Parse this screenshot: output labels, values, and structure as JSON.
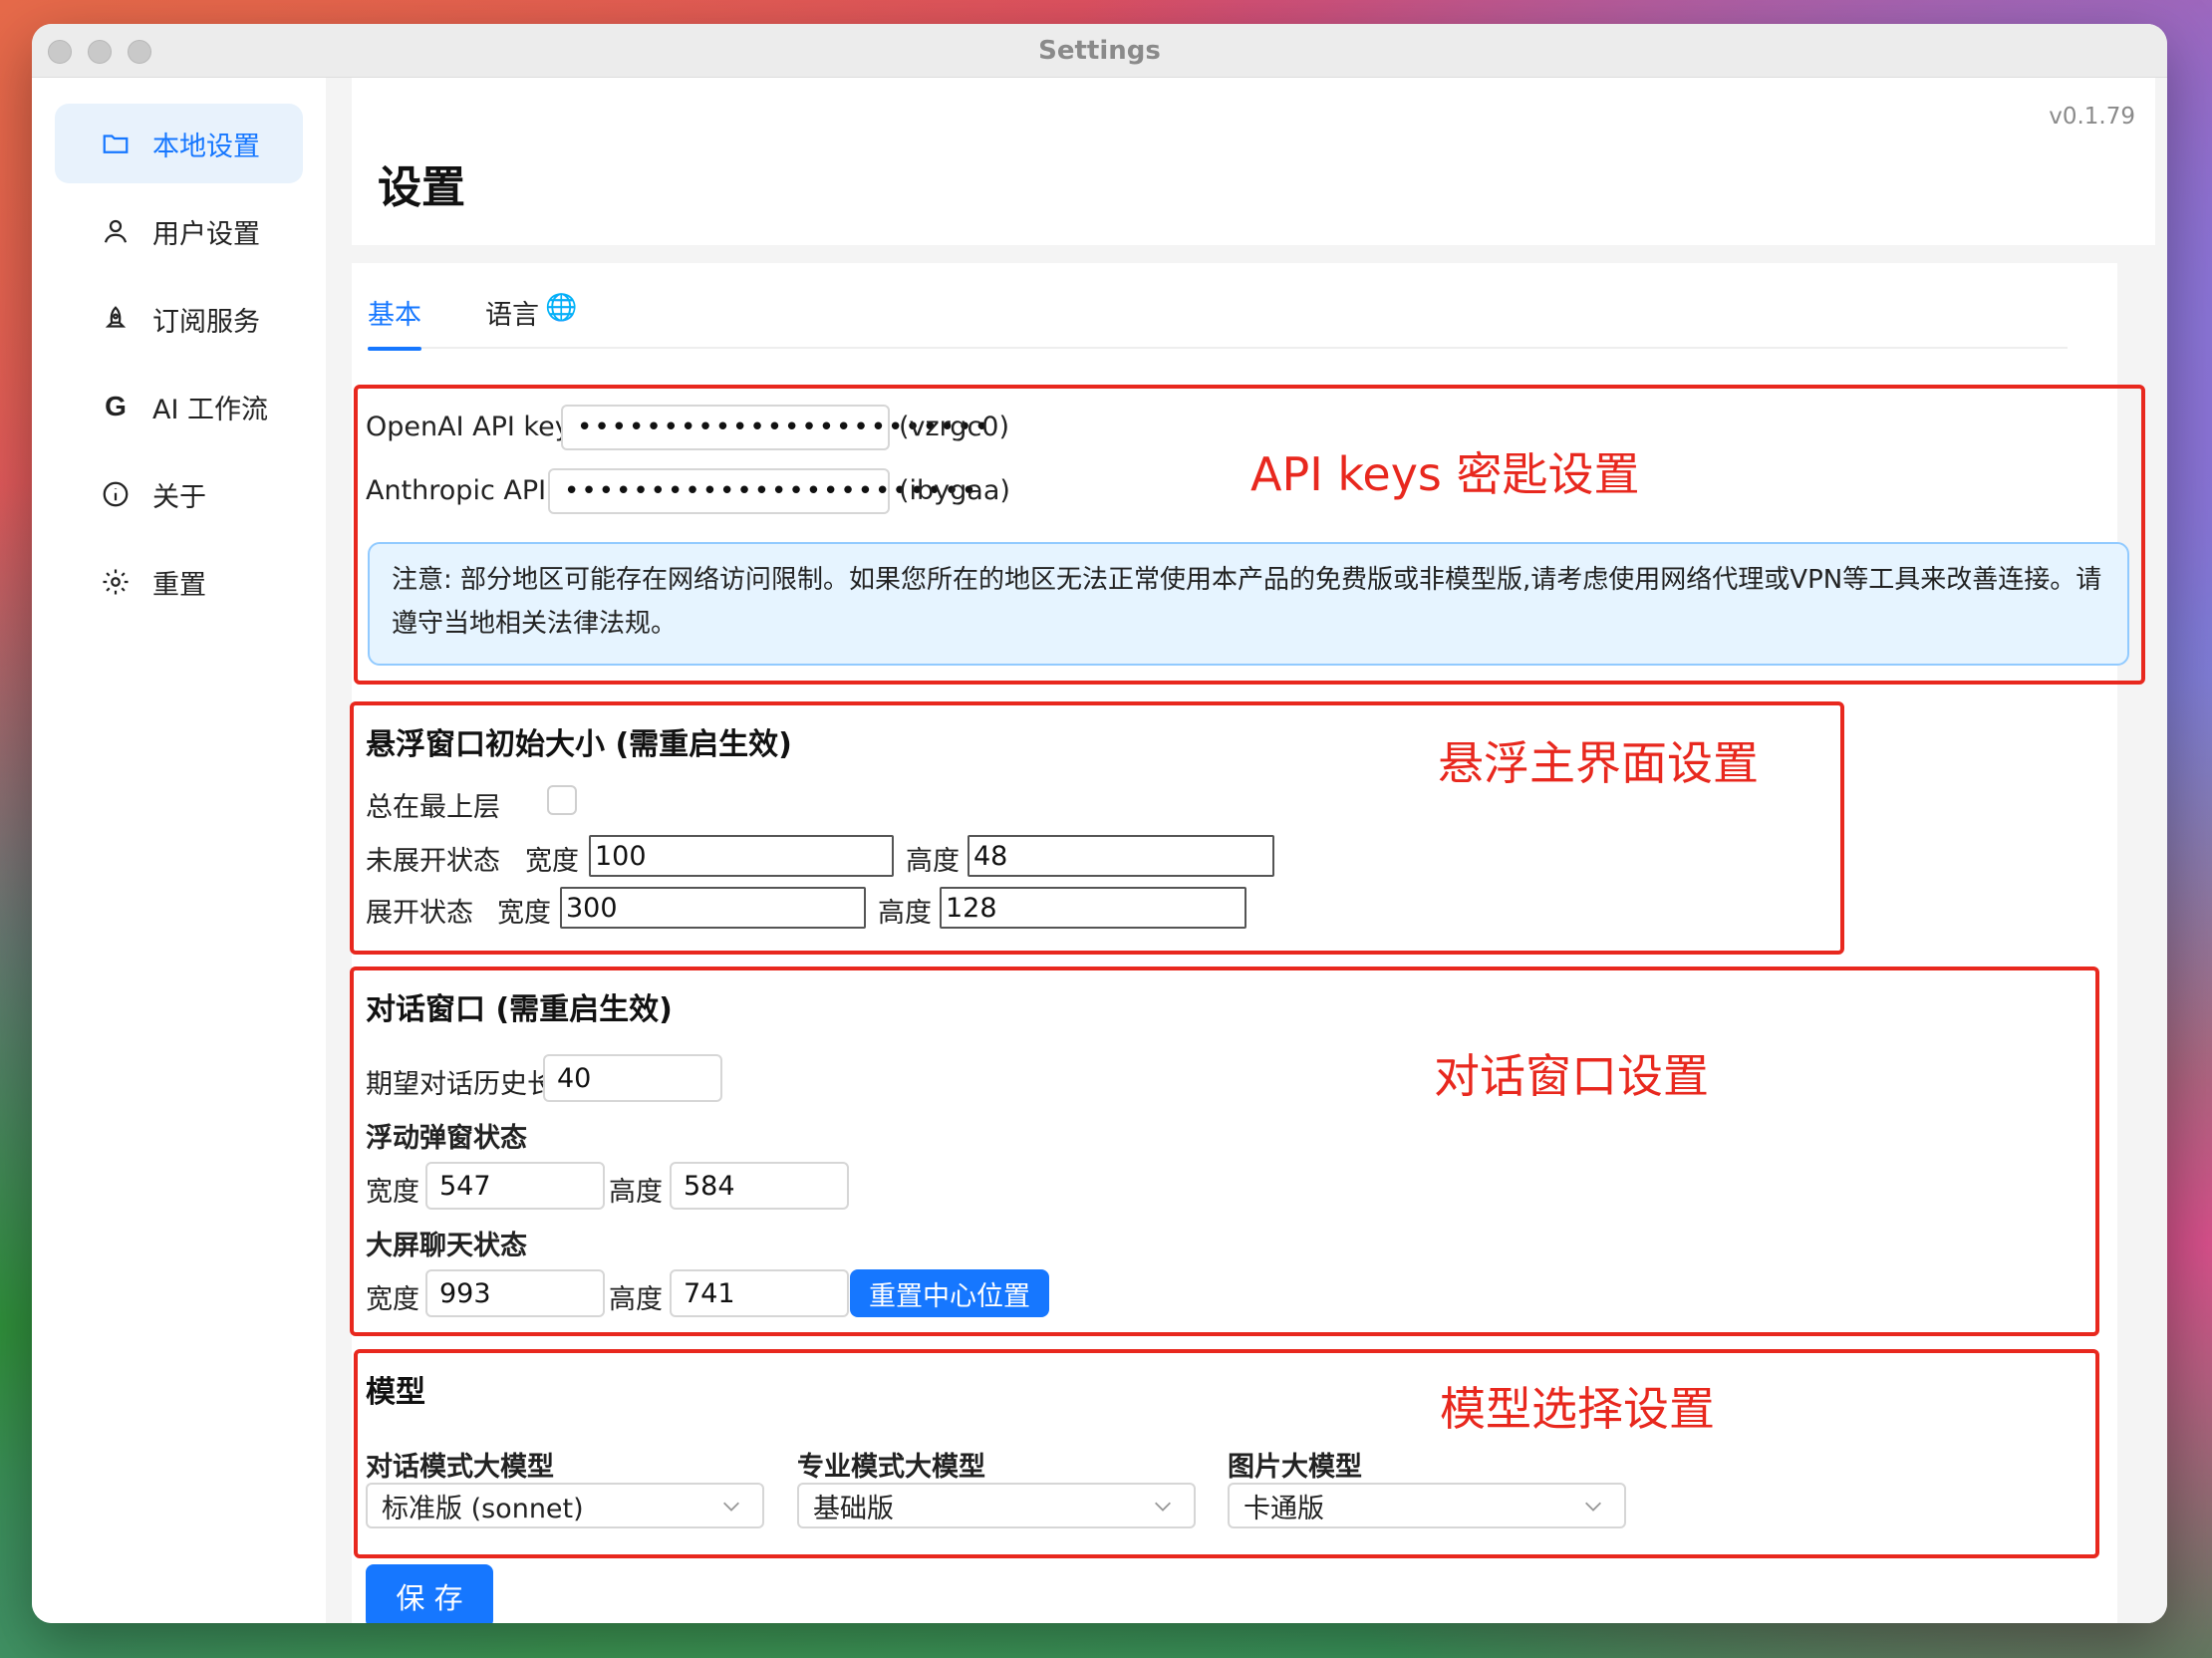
{
  "window": {
    "title": "Settings"
  },
  "sidebar": {
    "items": [
      {
        "label": "本地设置",
        "icon": "folder-icon",
        "active": true
      },
      {
        "label": "用户设置",
        "icon": "user-icon"
      },
      {
        "label": "订阅服务",
        "icon": "rocket-icon"
      },
      {
        "label": "AI 工作流",
        "icon": "google-g-icon"
      },
      {
        "label": "关于",
        "icon": "info-icon"
      },
      {
        "label": "重置",
        "icon": "gear-icon"
      }
    ]
  },
  "header": {
    "version": "v0.1.79",
    "title": "设置"
  },
  "tabs": [
    {
      "label": "基本",
      "active": true
    },
    {
      "label": "语言",
      "icon": "globe-icon"
    }
  ],
  "api_keys": {
    "openai_label": "OpenAI API key",
    "openai_colon": ":",
    "openai_value": "••••••••••••••••••••••••",
    "openai_suffix": "(vzrgc0)",
    "anthropic_label": "Anthropic API key :",
    "anthropic_value": "••••••••••••••••••••••••",
    "anthropic_suffix": "(ibygaa)",
    "notice": "注意: 部分地区可能存在网络访问限制。如果您所在的地区无法正常使用本产品的免费版或非模型版,请考虑使用网络代理或VPN等工具来改善连接。请遵守当地相关法律法规。"
  },
  "floating": {
    "title": "悬浮窗口初始大小 (需重启生效)",
    "always_on_top_label": "总在最上层",
    "collapsed_label": "未展开状态",
    "expanded_label": "展开状态",
    "width_label": "宽度",
    "height_label": "高度",
    "collapsed_width": "100",
    "collapsed_height": "48",
    "expanded_width": "300",
    "expanded_height": "128"
  },
  "chat": {
    "title": "对话窗口 (需重启生效)",
    "history_label": "期望对话历史长度 :",
    "history_value": "40",
    "popup_title": "浮动弹窗状态",
    "width_label": "宽度 :",
    "height_label": "高度 :",
    "popup_width": "547",
    "popup_height": "584",
    "big_title": "大屏聊天状态",
    "big_width": "993",
    "big_height": "741",
    "reset_button": "重置中心位置"
  },
  "model": {
    "title": "模型",
    "chat_model_label": "对话模式大模型",
    "chat_model_value": "标准版 (sonnet)",
    "pro_model_label": "专业模式大模型",
    "pro_model_value": "基础版",
    "image_model_label": "图片大模型",
    "image_model_value": "卡通版"
  },
  "save_button": "保 存",
  "annotations": {
    "api": "API keys 密匙设置",
    "floating": "悬浮主界面设置",
    "chat": "对话窗口设置",
    "model": "模型选择设置"
  },
  "colors": {
    "accent": "#1677ff",
    "annotation_red": "#e8281e",
    "notice_bg": "#e6f4ff"
  }
}
